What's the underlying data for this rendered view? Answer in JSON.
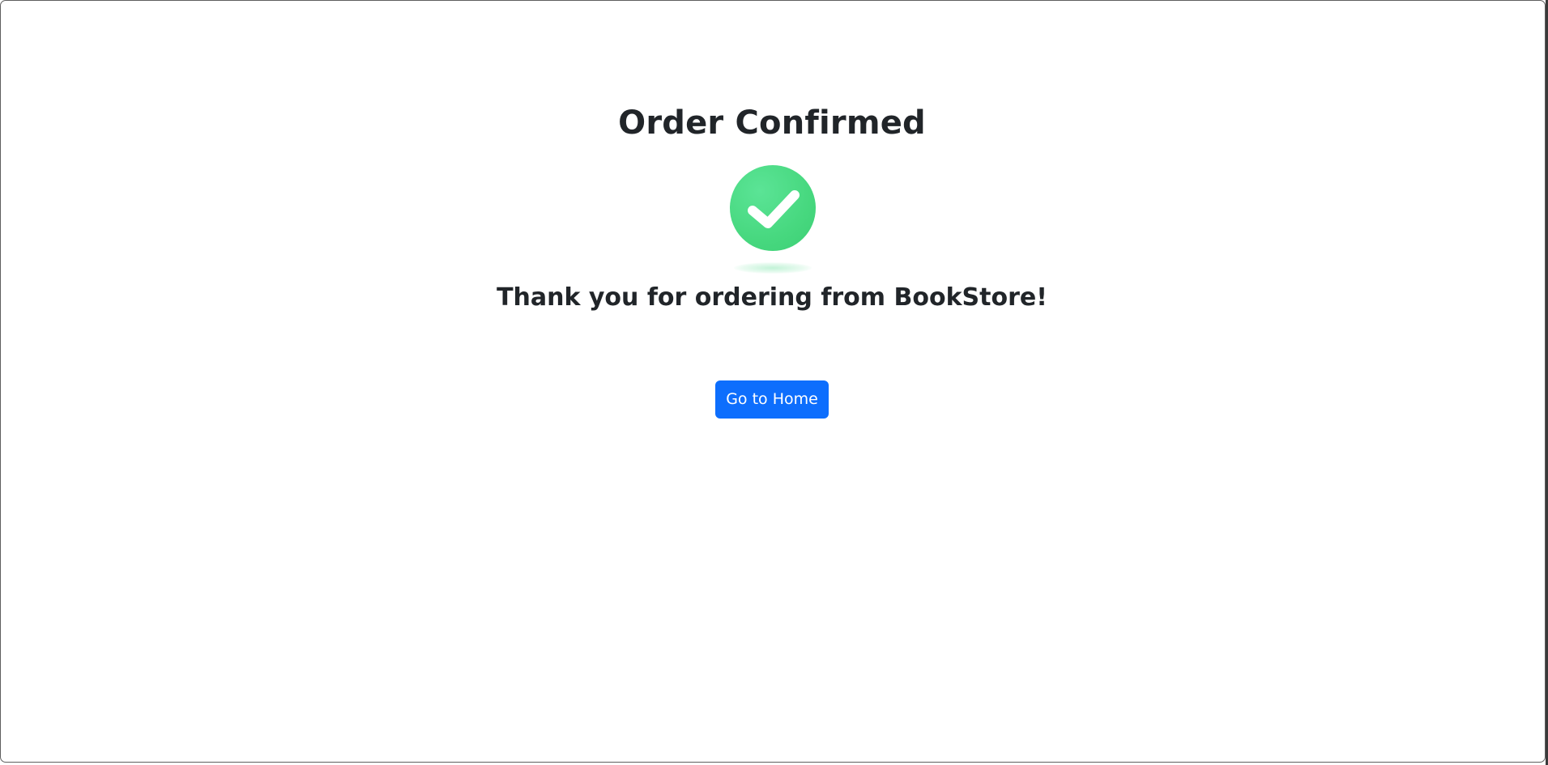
{
  "page": {
    "title": "Order Confirmed",
    "message": "Thank you for ordering from BookStore!",
    "status_icon": "check-circle-icon"
  },
  "actions": {
    "home_label": "Go to Home"
  },
  "colors": {
    "primary_button": "#0d6efd",
    "success": "#47d87f",
    "text": "#212529"
  }
}
